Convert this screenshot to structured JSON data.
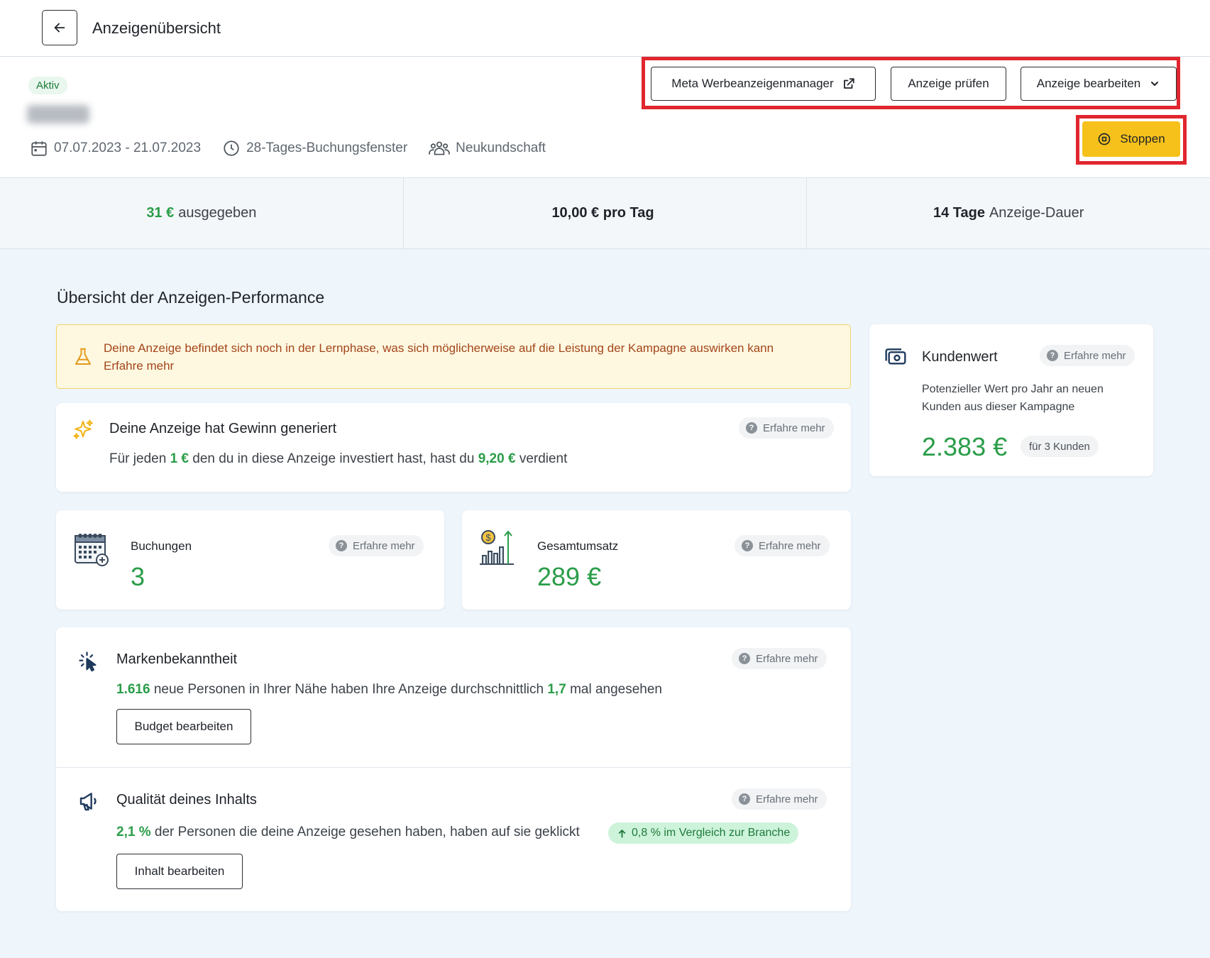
{
  "topbar": {
    "title": "Anzeigenübersicht"
  },
  "header": {
    "status": "Aktiv",
    "date_range": "07.07.2023 - 21.07.2023",
    "booking_window": "28-Tages-Buchungsfenster",
    "audience": "Neukundschaft",
    "buttons": {
      "meta_manager": "Meta Werbeanzeigenmanager",
      "review_ad": "Anzeige prüfen",
      "edit_ad": "Anzeige bearbeiten",
      "stop": "Stoppen"
    }
  },
  "stats": {
    "spent_value": "31 €",
    "spent_label": "ausgegeben",
    "per_day": "10,00 € pro Tag",
    "duration_value": "14 Tage",
    "duration_label": "Anzeige-Dauer"
  },
  "overview": {
    "title": "Übersicht der Anzeigen-Performance",
    "learn_more": "Erfahre mehr",
    "warning": {
      "text": "Deine Anzeige befindet sich noch in der Lernphase, was sich möglicherweise auf die Leistung der Kampagne auswirken kann",
      "link": "Erfahre mehr"
    },
    "profit": {
      "title": "Deine Anzeige hat Gewinn generiert",
      "t1": "Für jeden",
      "v1": "1 €",
      "t2": "den du in diese Anzeige investiert hast, hast du",
      "v2": "9,20 €",
      "t3": "verdient"
    },
    "bookings": {
      "title": "Buchungen",
      "value": "3"
    },
    "revenue": {
      "title": "Gesamtumsatz",
      "value": "289 €"
    },
    "brand": {
      "title": "Markenbekanntheit",
      "v1": "1.616",
      "t1": "neue Personen in Ihrer Nähe haben Ihre Anzeige durchschnittlich",
      "v2": "1,7",
      "t2": "mal angesehen",
      "button": "Budget bearbeiten"
    },
    "quality": {
      "title": "Qualität deines Inhalts",
      "v1": "2,1 %",
      "t1": "der Personen die deine Anzeige gesehen haben, haben auf sie geklickt",
      "compare": "0,8 % im Vergleich zur Branche",
      "button": "Inhalt bearbeiten"
    }
  },
  "customer_value": {
    "title": "Kundenwert",
    "learn_more": "Erfahre mehr",
    "description": "Potenzieller Wert pro Jahr an neuen Kunden aus dieser Kampagne",
    "value": "2.383 €",
    "customers": "für 3 Kunden"
  },
  "colors": {
    "accent_green": "#2a9d48",
    "stop_yellow": "#f6c11b",
    "highlight_red": "#e0262e",
    "warning_bg": "#fff8e1",
    "page_bg": "#eef5fb"
  },
  "icons": [
    "arrow-left-icon",
    "calendar-icon",
    "clock-icon",
    "people-icon",
    "external-link-icon",
    "chevron-down-icon",
    "stop-circle-icon",
    "flask-icon",
    "sparkle-icon",
    "calendar-grid-icon",
    "revenue-chart-icon",
    "cursor-click-icon",
    "megaphone-icon",
    "money-icon",
    "question-icon",
    "arrow-up-icon"
  ]
}
